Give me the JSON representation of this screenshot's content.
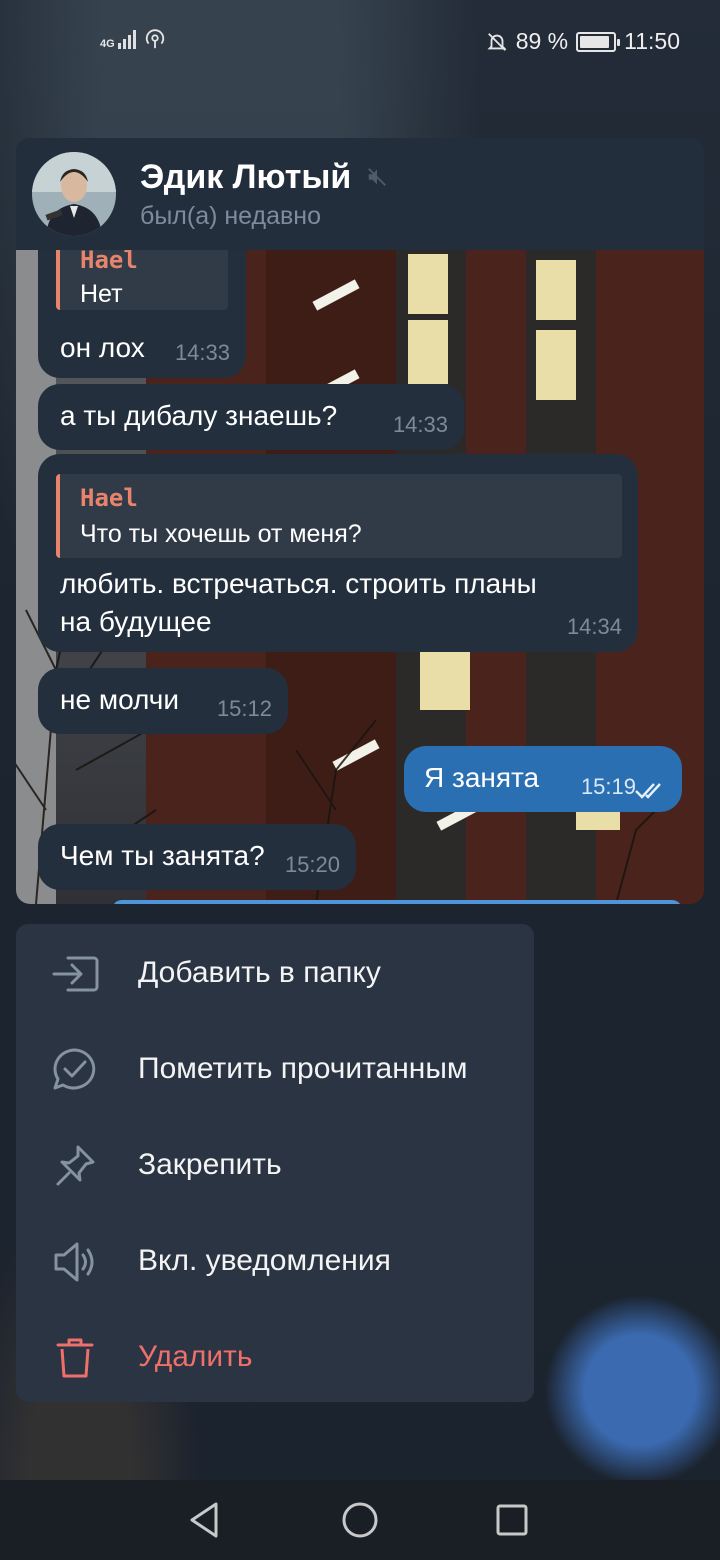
{
  "status_bar": {
    "network": "4G",
    "battery_percent": "89 %",
    "battery_level": 0.89,
    "time": "11:50",
    "icons": [
      "signal-icon",
      "hotspot-icon",
      "do-not-disturb-icon",
      "battery-icon"
    ]
  },
  "chat": {
    "contact_name": "Эдик Лютый",
    "contact_status": "был(а) недавно",
    "muted": true,
    "messages": [
      {
        "direction": "in",
        "reply_author": "Hael",
        "reply_text": "Нет",
        "text": "он лох",
        "time": "14:33"
      },
      {
        "direction": "in",
        "text": "а ты дибалу знаешь?",
        "time": "14:33"
      },
      {
        "direction": "in",
        "reply_author": "Hael",
        "reply_text": "Что ты хочешь от меня?",
        "text_line1": "любить. встречаться. строить планы",
        "text_line2": "на будущее",
        "time": "14:34"
      },
      {
        "direction": "in",
        "text": "не молчи",
        "time": "15:12"
      },
      {
        "direction": "out",
        "text": "Я занята",
        "time": "15:19",
        "read": true
      },
      {
        "direction": "in",
        "text": "Чем ты занята?",
        "time": "15:20"
      }
    ]
  },
  "menu": {
    "items": [
      {
        "label": "Добавить в папку",
        "icon": "add-to-folder-icon"
      },
      {
        "label": "Пометить прочитанным",
        "icon": "mark-read-icon"
      },
      {
        "label": "Закрепить",
        "icon": "pin-icon"
      },
      {
        "label": "Вкл. уведомления",
        "icon": "unmute-icon"
      },
      {
        "label": "Удалить",
        "icon": "trash-icon",
        "danger": true
      }
    ]
  },
  "nav_bar": {
    "buttons": [
      "back-icon",
      "home-icon",
      "recents-icon"
    ]
  },
  "colors": {
    "accent": "#2b6fb3",
    "danger": "#ef6f6a",
    "reply_accent": "#e8846c",
    "bubble_in": "#242f3d",
    "menu_bg": "#2a3443"
  }
}
